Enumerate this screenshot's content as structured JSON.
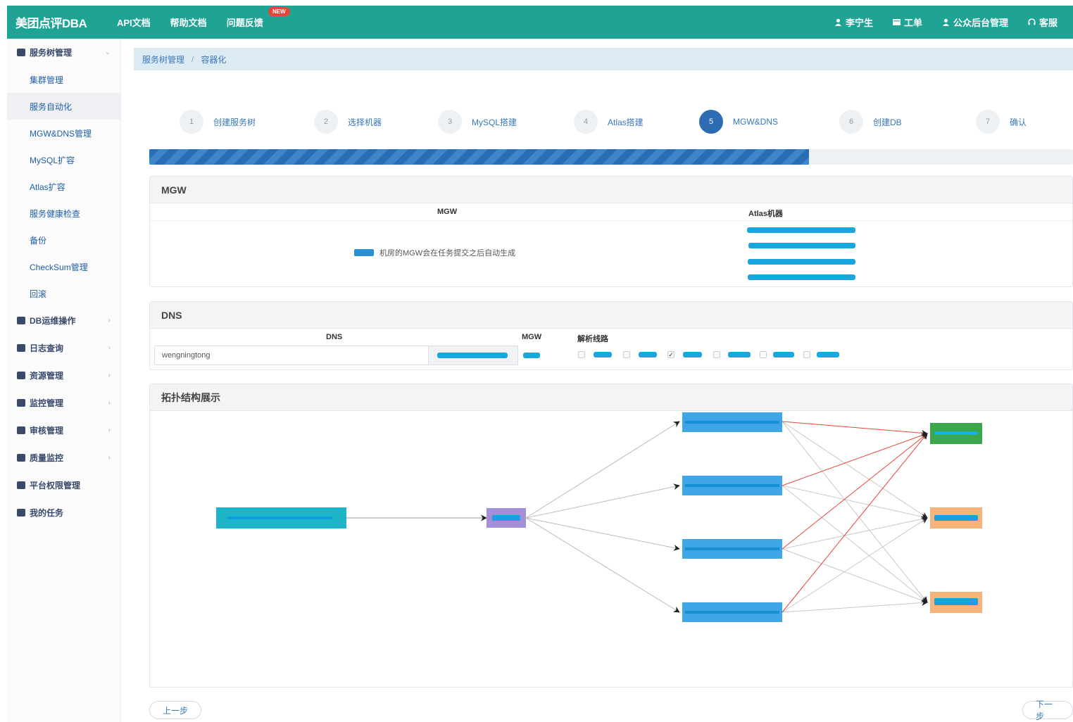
{
  "app": {
    "brand": "美团点评DBA"
  },
  "topnav": {
    "links": [
      "API文档",
      "帮助文档",
      "问题反馈"
    ],
    "new_badge": "NEW",
    "right": [
      "李宁生",
      "工单",
      "公众后台管理",
      "客服"
    ]
  },
  "sidebar": {
    "group1": "服务树管理",
    "items": [
      "集群管理",
      "服务自动化",
      "MGW&DNS管理",
      "MySQL扩容",
      "Atlas扩容",
      "服务健康检查",
      "备份",
      "CheckSum管理",
      "回滚"
    ],
    "groups": [
      "DB运维操作",
      "日志查询",
      "资源管理",
      "监控管理",
      "审核管理",
      "质量监控",
      "平台权限管理",
      "我的任务"
    ]
  },
  "breadcrumb": {
    "parent": "服务树管理",
    "current": "容器化"
  },
  "steps": [
    {
      "num": "1",
      "label": "创建服务树"
    },
    {
      "num": "2",
      "label": "选择机器"
    },
    {
      "num": "3",
      "label": "MySQL搭建"
    },
    {
      "num": "4",
      "label": "Atlas搭建"
    },
    {
      "num": "5",
      "label": "MGW&DNS"
    },
    {
      "num": "6",
      "label": "创建DB"
    },
    {
      "num": "7",
      "label": "确认"
    }
  ],
  "active_step_index": 4,
  "progress_fraction": 0.714,
  "mgw_panel": {
    "title": "MGW",
    "col_mgw": "MGW",
    "col_atlas": "Atlas机器",
    "hint": "机房的MGW会在任务提交之后自动生成"
  },
  "dns_panel": {
    "title": "DNS",
    "col_dns": "DNS",
    "col_mgw": "MGW",
    "col_route": "解析线路",
    "dns_value": "wengningtong",
    "checked_index": 2
  },
  "topology_panel": {
    "title": "拓扑结构展示"
  },
  "colors": {
    "primary": "#1fa395",
    "accent": "#2d6cb3",
    "node_cyan": "#1fb5c9",
    "node_blue": "#3ea6e6",
    "node_purple": "#a48fd8",
    "node_green": "#3aa84a",
    "node_orange": "#f5b57a",
    "edge_red": "#e8443a"
  },
  "buttons": {
    "prev": "上一步",
    "next": "下一步"
  }
}
